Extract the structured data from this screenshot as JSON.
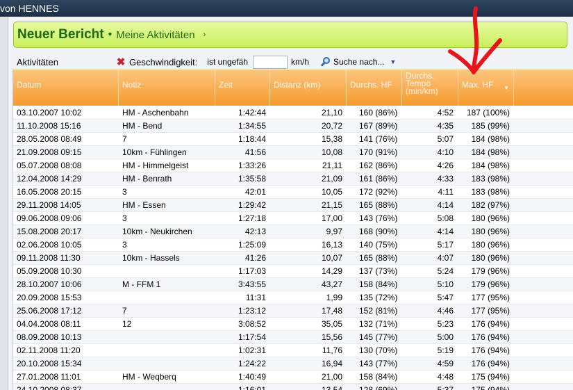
{
  "window": {
    "title": "von HENNES"
  },
  "report": {
    "title": "Neuer Bericht",
    "separator": "•",
    "subtitle": "Meine Aktivitäten",
    "chevron": "›"
  },
  "filter": {
    "section_label": "Aktivitäten",
    "remove_icon": "✖",
    "field": "Geschwindigkeit:",
    "operator": "ist ungefäh",
    "value": "",
    "unit": "km/h",
    "search_label": "Suche nach...",
    "dropdown_icon": "▼"
  },
  "table": {
    "columns": {
      "date": "Datum",
      "note": "Notiz",
      "time": "Zeit",
      "distance": "Distanz (km)",
      "avg_hf": "Durchs. HF",
      "tempo_1": "Durchs.",
      "tempo_2": "Tempo",
      "tempo_3": "(min/km)",
      "max_hf": "Max. HF",
      "sort_icon": "▼"
    },
    "rows": [
      {
        "date": "03.10.2007 10:02",
        "note": "HM - Aschenbahn",
        "time": "1:42:44",
        "dist": "21,10",
        "hf": "160 (86%)",
        "tempo": "4:52",
        "max": "187 (100%)"
      },
      {
        "date": "11.10.2008 15:16",
        "note": "HM - Bend",
        "time": "1:34:55",
        "dist": "20,72",
        "hf": "167 (89%)",
        "tempo": "4:35",
        "max": "185 (99%)"
      },
      {
        "date": "28.05.2008 08:49",
        "note": "7",
        "time": "1:18:44",
        "dist": "15,38",
        "hf": "141 (76%)",
        "tempo": "5:07",
        "max": "184 (98%)"
      },
      {
        "date": "21.09.2008 09:15",
        "note": "10km - Fühlingen",
        "time": "41:56",
        "dist": "10,08",
        "hf": "170 (91%)",
        "tempo": "4:10",
        "max": "184 (98%)"
      },
      {
        "date": "05.07.2008 08:08",
        "note": "HM - Himmelgeist",
        "time": "1:33:26",
        "dist": "21,11",
        "hf": "162 (86%)",
        "tempo": "4:26",
        "max": "184 (98%)"
      },
      {
        "date": "12.04.2008 14:29",
        "note": "HM - Benrath",
        "time": "1:35:58",
        "dist": "21,09",
        "hf": "161 (86%)",
        "tempo": "4:33",
        "max": "183 (98%)"
      },
      {
        "date": "16.05.2008 20:15",
        "note": "3",
        "time": "42:01",
        "dist": "10,05",
        "hf": "172 (92%)",
        "tempo": "4:11",
        "max": "183 (98%)"
      },
      {
        "date": "29.11.2008 14:05",
        "note": "HM - Essen",
        "time": "1:29:42",
        "dist": "21,15",
        "hf": "165 (88%)",
        "tempo": "4:14",
        "max": "182 (97%)"
      },
      {
        "date": "09.06.2008 09:06",
        "note": "3",
        "time": "1:27:18",
        "dist": "17,00",
        "hf": "143 (76%)",
        "tempo": "5:08",
        "max": "180 (96%)"
      },
      {
        "date": "15.08.2008 20:17",
        "note": "10km - Neukirchen",
        "time": "42:13",
        "dist": "9,97",
        "hf": "168 (90%)",
        "tempo": "4:14",
        "max": "180 (96%)"
      },
      {
        "date": "02.06.2008 10:05",
        "note": "3",
        "time": "1:25:09",
        "dist": "16,13",
        "hf": "140 (75%)",
        "tempo": "5:17",
        "max": "180 (96%)"
      },
      {
        "date": "09.11.2008 11:30",
        "note": "10km - Hassels",
        "time": "41:26",
        "dist": "10,07",
        "hf": "165 (88%)",
        "tempo": "4:07",
        "max": "180 (96%)"
      },
      {
        "date": "05.09.2008 10:30",
        "note": "",
        "time": "1:17:03",
        "dist": "14,29",
        "hf": "137 (73%)",
        "tempo": "5:24",
        "max": "179 (96%)"
      },
      {
        "date": "28.10.2007 10:06",
        "note": "M - FFM 1",
        "time": "3:43:55",
        "dist": "43,27",
        "hf": "158 (84%)",
        "tempo": "5:10",
        "max": "179 (96%)"
      },
      {
        "date": "20.09.2008 15:53",
        "note": "",
        "time": "11:31",
        "dist": "1,99",
        "hf": "135 (72%)",
        "tempo": "5:47",
        "max": "177 (95%)"
      },
      {
        "date": "25.06.2008 17:12",
        "note": "7",
        "time": "1:23:12",
        "dist": "17,48",
        "hf": "152 (81%)",
        "tempo": "4:46",
        "max": "177 (95%)"
      },
      {
        "date": "04.04.2008 08:11",
        "note": "12",
        "time": "3:08:52",
        "dist": "35,05",
        "hf": "132 (71%)",
        "tempo": "5:23",
        "max": "176 (94%)"
      },
      {
        "date": "08.09.2008 10:13",
        "note": "",
        "time": "1:17:54",
        "dist": "15,56",
        "hf": "145 (77%)",
        "tempo": "5:00",
        "max": "176 (94%)"
      },
      {
        "date": "02.11.2008 11:20",
        "note": "",
        "time": "1:02:31",
        "dist": "11,76",
        "hf": "130 (70%)",
        "tempo": "5:19",
        "max": "176 (94%)"
      },
      {
        "date": "20.10.2008 15:34",
        "note": "",
        "time": "1:24:22",
        "dist": "16,94",
        "hf": "143 (77%)",
        "tempo": "4:59",
        "max": "176 (94%)"
      },
      {
        "date": "27.01.2008 11:01",
        "note": "HM - Weqberq",
        "time": "1:40:49",
        "dist": "21,00",
        "hf": "158 (84%)",
        "tempo": "4:48",
        "max": "175 (94%)"
      },
      {
        "date": "24.10.2008 08:37",
        "note": "",
        "time": "1:16:01",
        "dist": "13,54",
        "hf": "128 (69%)",
        "tempo": "5:37",
        "max": "175 (94%)"
      }
    ]
  },
  "annotation": {
    "color": "#e8141b"
  }
}
